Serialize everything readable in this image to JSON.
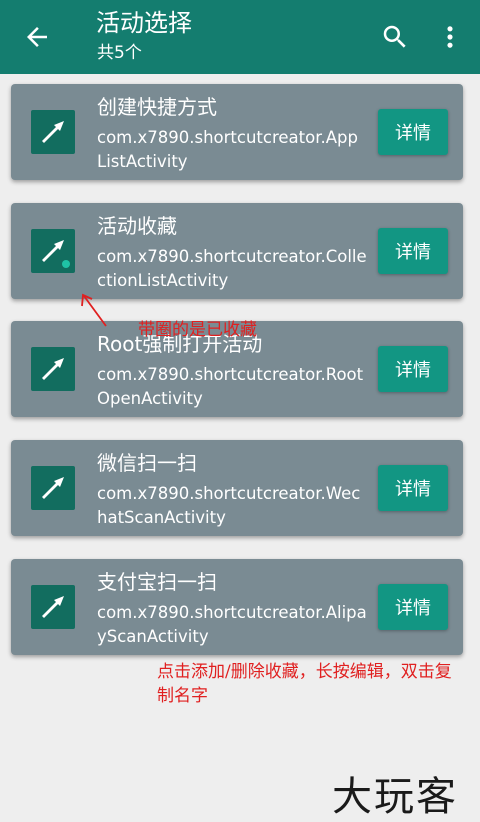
{
  "appbar": {
    "title": "活动选择",
    "subtitle": "共5个",
    "color": "#147d6f"
  },
  "items": [
    {
      "name": "创建快捷方式",
      "class": "com.x7890.shortcutcreator.AppListActivity",
      "detail": "详情",
      "favorited": false
    },
    {
      "name": "活动收藏",
      "class": "com.x7890.shortcutcreator.CollectionListActivity",
      "detail": "详情",
      "favorited": true
    },
    {
      "name": "Root强制打开活动",
      "class": "com.x7890.shortcutcreator.RootOpenActivity",
      "detail": "详情",
      "favorited": false
    },
    {
      "name": "微信扫一扫",
      "class": "com.x7890.shortcutcreator.WechatScanActivity",
      "detail": "详情",
      "favorited": false
    },
    {
      "name": "支付宝扫一扫",
      "class": "com.x7890.shortcutcreator.AlipayScanActivity",
      "detail": "详情",
      "favorited": false
    }
  ],
  "annotations": {
    "favorite_note": "带圈的是已收藏",
    "usage_note": "点击添加/删除收藏，长按编辑，双击复制名字"
  },
  "watermark": "大玩客"
}
